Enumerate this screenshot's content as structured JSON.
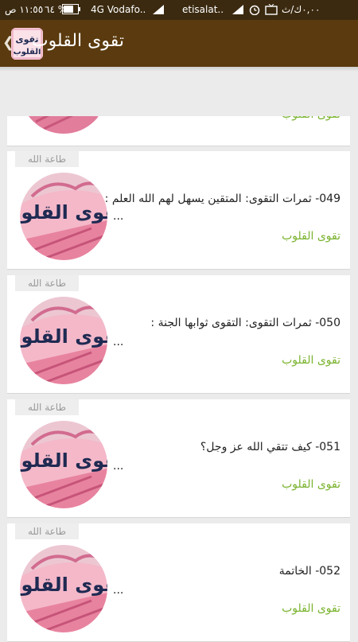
{
  "status_bar": {
    "time": "١١:٥٥ ص",
    "battery": "٦٤ %",
    "carrier1": "4G Vodafo..",
    "carrier2": "etisalat..",
    "speed": "٠,٠٠ك/ث"
  },
  "app_bar": {
    "title": "تقوى القلوب",
    "back_icon": "chevron-left-icon",
    "icon_text": "تقوى القلوب"
  },
  "thumbnail": {
    "text": "تقوى القلوب"
  },
  "articles": [
    {
      "category": "طاعة الله",
      "title": "049- ثمرات التقوى: المتقين يسهل لهم الله العلم :",
      "ellipsis": "...",
      "source": "تقوى القلوب"
    },
    {
      "category": "طاعة الله",
      "title": "050- ثمرات التقوى: التقوى ثوابها الجنة :",
      "ellipsis": "...",
      "source": "تقوى القلوب"
    },
    {
      "category": "طاعة الله",
      "title": "051- كيف تتقي الله عز وجل؟",
      "ellipsis": "...",
      "source": "تقوى القلوب"
    },
    {
      "category": "طاعة الله",
      "title": "052- الخاتمة",
      "ellipsis": "...",
      "source": "تقوى القلوب"
    }
  ],
  "colors": {
    "appbar": "#5a3a0e",
    "source_green": "#7ab32e",
    "thumb_pink": "#f2a9bd",
    "thumb_text": "#1f2a52"
  }
}
